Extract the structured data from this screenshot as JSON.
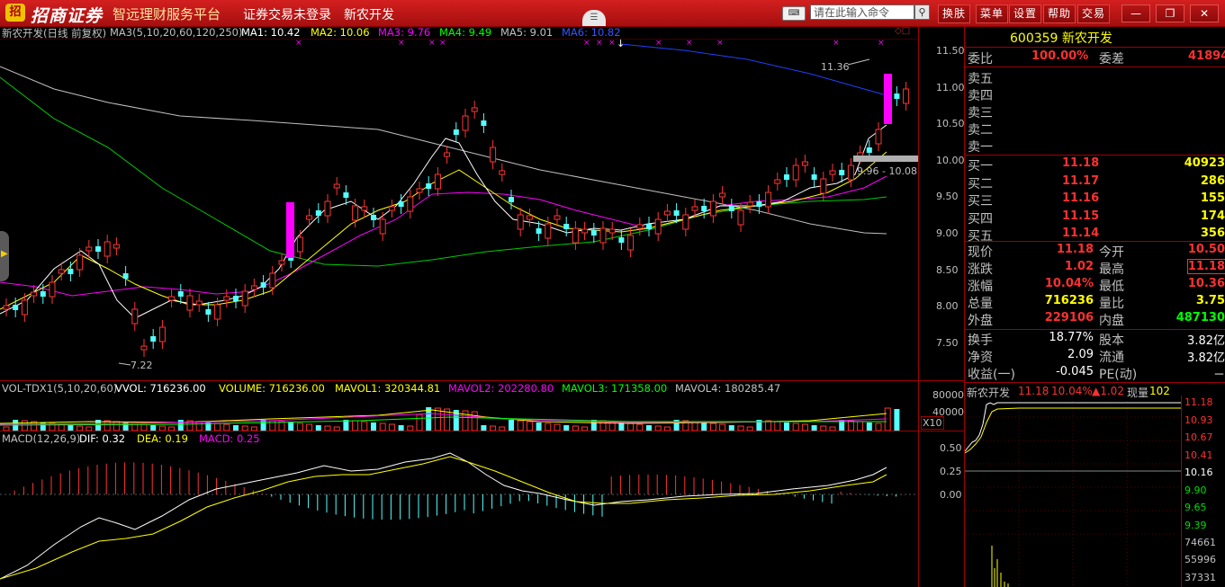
{
  "app": {
    "logo_char": "招",
    "brand": "招商证券",
    "subbrand": "智远理财服务平台",
    "menu": [
      "证券交易未登录",
      "新农开发"
    ],
    "search_placeholder": "请在此输入命令",
    "buttons": [
      "换肤",
      "菜单",
      "设置",
      "帮助",
      "交易"
    ],
    "window_controls": [
      "minimize",
      "restore",
      "close"
    ],
    "icons": [
      "keyboard-icon",
      "search-icon",
      "collapse-arrow-icon"
    ]
  },
  "kline_header": {
    "title": "新农开发(日线 前复权)",
    "ma_params": "MA3(5,10,20,60,120,250)",
    "ma": [
      {
        "label": "MA1: 10.42",
        "color": "#ffffff"
      },
      {
        "label": "MA2: 10.06",
        "color": "#ffff00"
      },
      {
        "label": "MA3: 9.76",
        "color": "#ff00ff"
      },
      {
        "label": "MA4: 9.49",
        "color": "#00ff00"
      },
      {
        "label": "MA5: 9.01",
        "color": "#c0c0c0"
      },
      {
        "label": "MA6: 10.82",
        "color": "#3355ff"
      }
    ]
  },
  "price_axis": [
    "11.50",
    "11.00",
    "10.50",
    "10.00",
    "9.50",
    "9.00",
    "8.50",
    "8.00",
    "7.50"
  ],
  "price_labels": {
    "high": "11.36",
    "low": "7.22",
    "range": "9.96 - 10.08"
  },
  "volume_header": {
    "label": "VOL-TDX1(5,10,20,60)",
    "items": [
      {
        "label": "VVOL: 716236.00",
        "color": "#ffffff"
      },
      {
        "label": "VOLUME: 716236.00",
        "color": "#ffff00"
      },
      {
        "label": "MAVOL1: 320344.81",
        "color": "#ffff00"
      },
      {
        "label": "MAVOL2: 202280.80",
        "color": "#ff00ff"
      },
      {
        "label": "MAVOL3: 171358.00",
        "color": "#00ff00"
      },
      {
        "label": "MAVOL4: 180285.47",
        "color": "#c0c0c0"
      }
    ]
  },
  "volume_axis": [
    "80000",
    "40000"
  ],
  "volume_unit": "X10",
  "macd_header": {
    "label": "MACD(12,26,9)",
    "items": [
      {
        "label": "DIF: 0.32",
        "color": "#ffffff"
      },
      {
        "label": "DEA: 0.19",
        "color": "#ffff00"
      },
      {
        "label": "MACD: 0.25",
        "color": "#ff00ff"
      }
    ]
  },
  "macd_axis": [
    "0.50",
    "0.25",
    "0.00"
  ],
  "quote": {
    "code_name": "600359 新农开发",
    "weibi_label": "委比",
    "weibi_value": "100.00%",
    "weicha_label": "委差",
    "weicha_value": "41894",
    "sells": [
      "卖五",
      "卖四",
      "卖三",
      "卖二",
      "卖一"
    ],
    "buys": [
      {
        "label": "买一",
        "price": "11.18",
        "vol": "40923"
      },
      {
        "label": "买二",
        "price": "11.17",
        "vol": "286"
      },
      {
        "label": "买三",
        "price": "11.16",
        "vol": "155"
      },
      {
        "label": "买四",
        "price": "11.15",
        "vol": "174"
      },
      {
        "label": "买五",
        "price": "11.14",
        "vol": "356"
      }
    ],
    "stats": [
      {
        "l1": "现价",
        "v1": "11.18",
        "c1": "#ff3030",
        "l2": "今开",
        "v2": "10.50",
        "c2": "#ff3030"
      },
      {
        "l1": "涨跌",
        "v1": "1.02",
        "c1": "#ff3030",
        "l2": "最高",
        "v2": "11.18",
        "c2": "#ff3030"
      },
      {
        "l1": "涨幅",
        "v1": "10.04%",
        "c1": "#ff3030",
        "l2": "最低",
        "v2": "10.36",
        "c2": "#ff3030"
      },
      {
        "l1": "总量",
        "v1": "716236",
        "c1": "#ffff00",
        "l2": "量比",
        "v2": "3.75",
        "c2": "#ffff00"
      },
      {
        "l1": "外盘",
        "v1": "229106",
        "c1": "#ff3030",
        "l2": "内盘",
        "v2": "487130",
        "c2": "#00ff00"
      }
    ],
    "stats2": [
      {
        "l1": "换手",
        "v1": "18.77%",
        "l2": "股本",
        "v2": "3.82亿"
      },
      {
        "l1": "净资",
        "v1": "2.09",
        "l2": "流通",
        "v2": "3.82亿"
      },
      {
        "l1": "收益(一)",
        "v1": "-0.045",
        "l2": "PE(动)",
        "v2": "－"
      }
    ]
  },
  "minute": {
    "title": "新农开发",
    "price": "11.18",
    "pct": "10.04%",
    "change": "▲1.02",
    "vol_label": "现量",
    "vol": "102",
    "price_axis": [
      {
        "v": "11.18",
        "c": "#ff3030"
      },
      {
        "v": "10.93",
        "c": "#ff3030"
      },
      {
        "v": "10.67",
        "c": "#ff3030"
      },
      {
        "v": "10.41",
        "c": "#ff3030"
      },
      {
        "v": "10.16",
        "c": "#ffffff"
      },
      {
        "v": "9.90",
        "c": "#00dd00"
      },
      {
        "v": "9.65",
        "c": "#00dd00"
      },
      {
        "v": "9.39",
        "c": "#00dd00"
      }
    ],
    "vol_axis": [
      "74661",
      "55996",
      "37331"
    ]
  }
}
